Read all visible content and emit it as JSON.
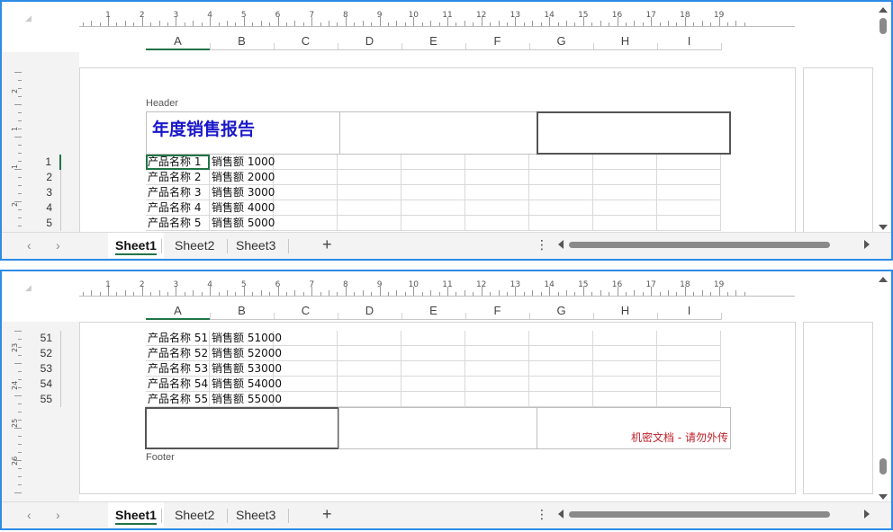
{
  "ruler": {
    "numbers": [
      "1",
      "2",
      "3",
      "4",
      "5",
      "6",
      "7",
      "8",
      "9",
      "10",
      "11",
      "12",
      "13",
      "14",
      "15",
      "16",
      "17",
      "18",
      "19"
    ]
  },
  "columns": [
    "A",
    "B",
    "C",
    "D",
    "E",
    "F",
    "G",
    "H",
    "I"
  ],
  "header": {
    "label": "Header",
    "title": "年度销售报告",
    "title_color": "#1a17c8"
  },
  "footer": {
    "label": "Footer",
    "right_text": "机密文档 - 请勿外传",
    "text_color": "#c2202a"
  },
  "top_rows": [
    {
      "num": "1",
      "a": "产品名称 1",
      "b": "销售额 1000"
    },
    {
      "num": "2",
      "a": "产品名称 2",
      "b": "销售额 2000"
    },
    {
      "num": "3",
      "a": "产品名称 3",
      "b": "销售额 3000"
    },
    {
      "num": "4",
      "a": "产品名称 4",
      "b": "销售额 4000"
    },
    {
      "num": "5",
      "a": "产品名称 5",
      "b": "销售额 5000"
    }
  ],
  "bottom_rows": [
    {
      "num": "51",
      "a": "产品名称 51",
      "b": "销售额 51000"
    },
    {
      "num": "52",
      "a": "产品名称 52",
      "b": "销售额 52000"
    },
    {
      "num": "53",
      "a": "产品名称 53",
      "b": "销售额 53000"
    },
    {
      "num": "54",
      "a": "产品名称 54",
      "b": "销售额 54000"
    },
    {
      "num": "55",
      "a": "产品名称 55",
      "b": "销售额 55000"
    }
  ],
  "vruler_top": [
    "2",
    "1",
    "1",
    "2"
  ],
  "vruler_bottom": [
    "23",
    "24",
    "25",
    "26"
  ],
  "sheets": [
    "Sheet1",
    "Sheet2",
    "Sheet3"
  ],
  "active_sheet": "Sheet1",
  "nav": {
    "prev": "‹",
    "next": "›",
    "add": "+",
    "more": "⋮"
  },
  "accent": "#217346",
  "pane_border": "#2e8be6"
}
